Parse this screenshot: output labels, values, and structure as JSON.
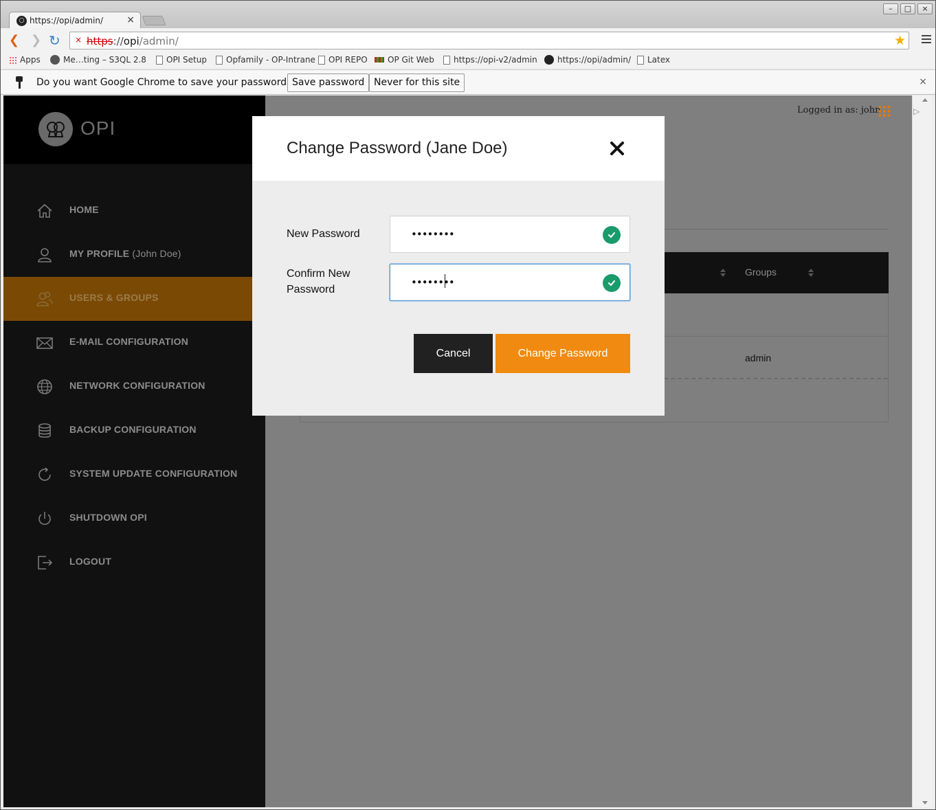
{
  "browser": {
    "tab_title": "https://opi/admin/",
    "url": {
      "scheme": "https",
      "sep": "://",
      "host": "opi",
      "path": "/admin/"
    },
    "bookmarks": [
      {
        "label": "Apps",
        "icon": "apps-grid-icon"
      },
      {
        "label": "Me…ting – S3QL 2.8",
        "icon": "site-icon"
      },
      {
        "label": "OPI Setup",
        "icon": "page-icon"
      },
      {
        "label": "Opfamily - OP-Intrane",
        "icon": "page-icon"
      },
      {
        "label": "OPI REPO",
        "icon": "page-icon"
      },
      {
        "label": "OP Git Web",
        "icon": "git-icon"
      },
      {
        "label": "https://opi-v2/admin",
        "icon": "page-icon"
      },
      {
        "label": "https://opi/admin/",
        "icon": "opi-favicon-icon"
      },
      {
        "label": "Latex",
        "icon": "page-icon"
      }
    ],
    "infobar": {
      "question": "Do you want Google Chrome to save your password?",
      "save_label": "Save password",
      "never_label": "Never for this site"
    }
  },
  "app": {
    "logo_text": "OPI",
    "logged_in": "Logged in as: john",
    "nav": [
      {
        "label": "HOME",
        "sub": "",
        "icon": "home-icon"
      },
      {
        "label": "MY PROFILE",
        "sub": " (John Doe)",
        "icon": "user-icon"
      },
      {
        "label": "USERS & GROUPS",
        "sub": "",
        "icon": "users-icon",
        "active": true
      },
      {
        "label": "E-MAIL CONFIGURATION",
        "sub": "",
        "icon": "envelope-icon"
      },
      {
        "label": "NETWORK CONFIGURATION",
        "sub": "",
        "icon": "globe-icon"
      },
      {
        "label": "BACKUP CONFIGURATION",
        "sub": "",
        "icon": "database-icon"
      },
      {
        "label": "SYSTEM UPDATE CONFIGURATION",
        "sub": "",
        "icon": "refresh-icon"
      },
      {
        "label": "SHUTDOWN OPI",
        "sub": "",
        "icon": "power-icon"
      },
      {
        "label": "LOGOUT",
        "sub": "",
        "icon": "logout-icon"
      }
    ],
    "table": {
      "groups_header": "Groups",
      "row_group": "admin"
    }
  },
  "modal": {
    "title": "Change Password (Jane Doe)",
    "new_password_label": "New Password",
    "new_password_value": "••••••••",
    "confirm_label": "Confirm New Password",
    "confirm_value": "••••••••",
    "cancel_label": "Cancel",
    "submit_label": "Change Password"
  },
  "colors": {
    "accent": "#f08a10",
    "active_nav": "#7a4a05",
    "valid": "#1a9b6c",
    "sidebar": "#111111"
  }
}
